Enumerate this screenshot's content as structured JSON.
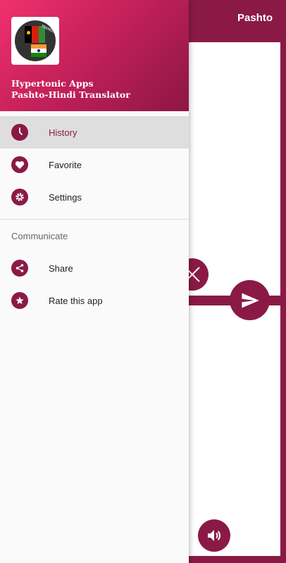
{
  "app": {
    "title": "Pashto"
  },
  "drawer": {
    "header_line1": "Hypertonic Apps",
    "header_line2": "Pashto-Hindi Translator",
    "logo_text": "TRANSLATOR",
    "items": [
      {
        "label": "History",
        "icon": "clock-icon"
      },
      {
        "label": "Favorite",
        "icon": "heart-icon"
      },
      {
        "label": "Settings",
        "icon": "gear-icon"
      }
    ],
    "section_title": "Communicate",
    "communicate_items": [
      {
        "label": "Share",
        "icon": "share-icon"
      },
      {
        "label": "Rate this app",
        "icon": "star-icon"
      }
    ]
  },
  "colors": {
    "primary": "#8a1a45",
    "header_gradient_start": "#f0306e",
    "header_gradient_end": "#8d1644",
    "active_item_bg": "#dedede"
  }
}
